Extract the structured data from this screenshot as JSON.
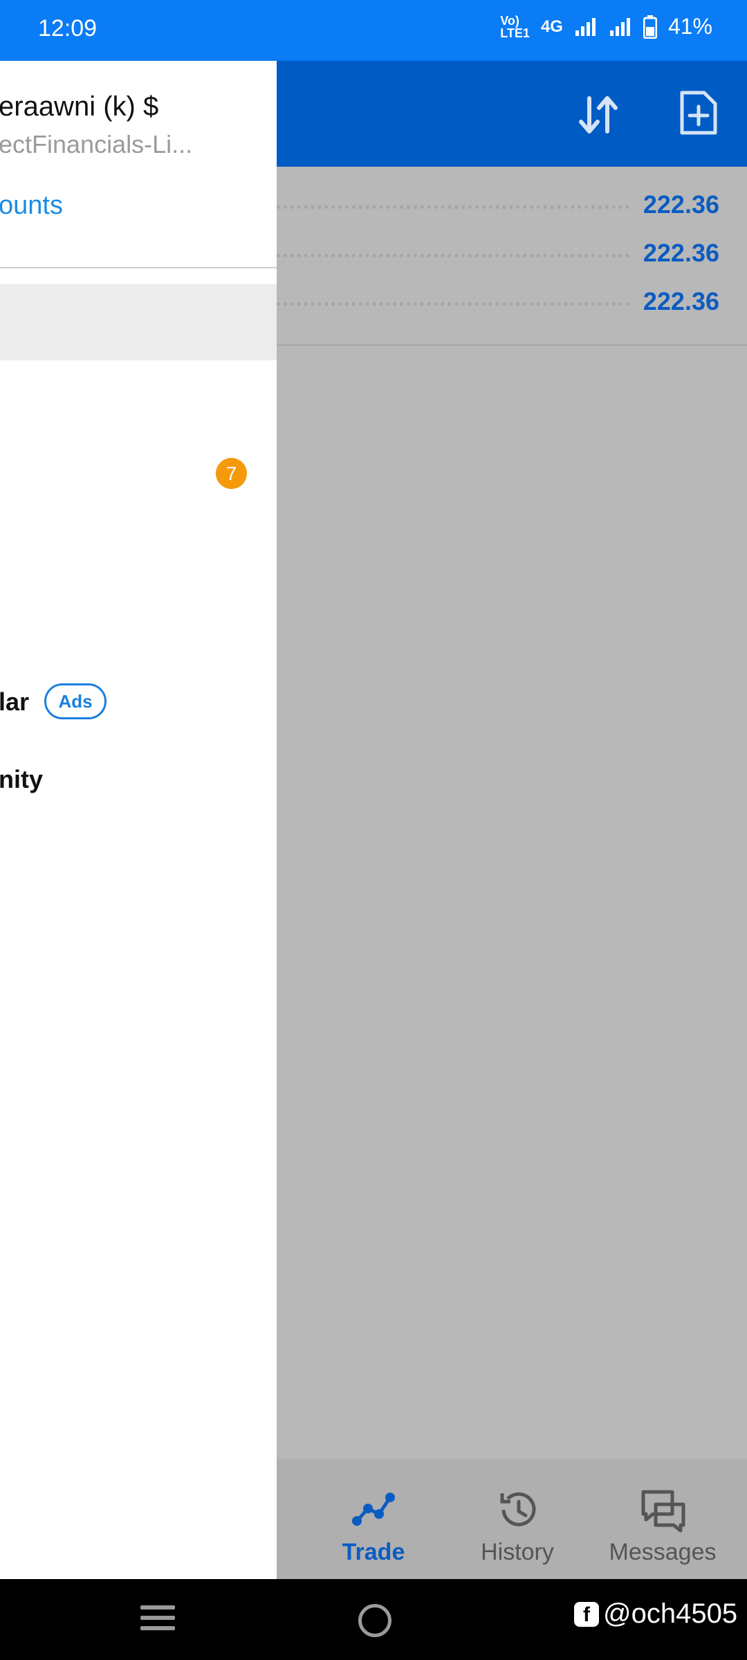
{
  "status_bar": {
    "time": "12:09",
    "volte": "VoLTE1",
    "network": "4G",
    "battery": "41%"
  },
  "app": {
    "prices": [
      "222.36",
      "222.36",
      "222.36"
    ],
    "bottom_nav": [
      {
        "label": "Trade",
        "icon": "trade-chart-icon",
        "active": true
      },
      {
        "label": "History",
        "icon": "history-icon",
        "active": false
      },
      {
        "label": "Messages",
        "icon": "messages-icon",
        "active": false
      }
    ]
  },
  "drawer": {
    "account_name": "eraawni (k) $",
    "server": "ectFinancials-Li...",
    "manage_link": "ounts",
    "badge_count": "7",
    "items": {
      "calendar": "lar",
      "ads_label": "Ads",
      "community": "nity"
    }
  },
  "system": {
    "watermark": "@och4505"
  },
  "colors": {
    "status_bar": "#0a7cf5",
    "app_bar": "#005bc4",
    "accent": "#0b5cc2",
    "badge": "#f59a0b"
  }
}
